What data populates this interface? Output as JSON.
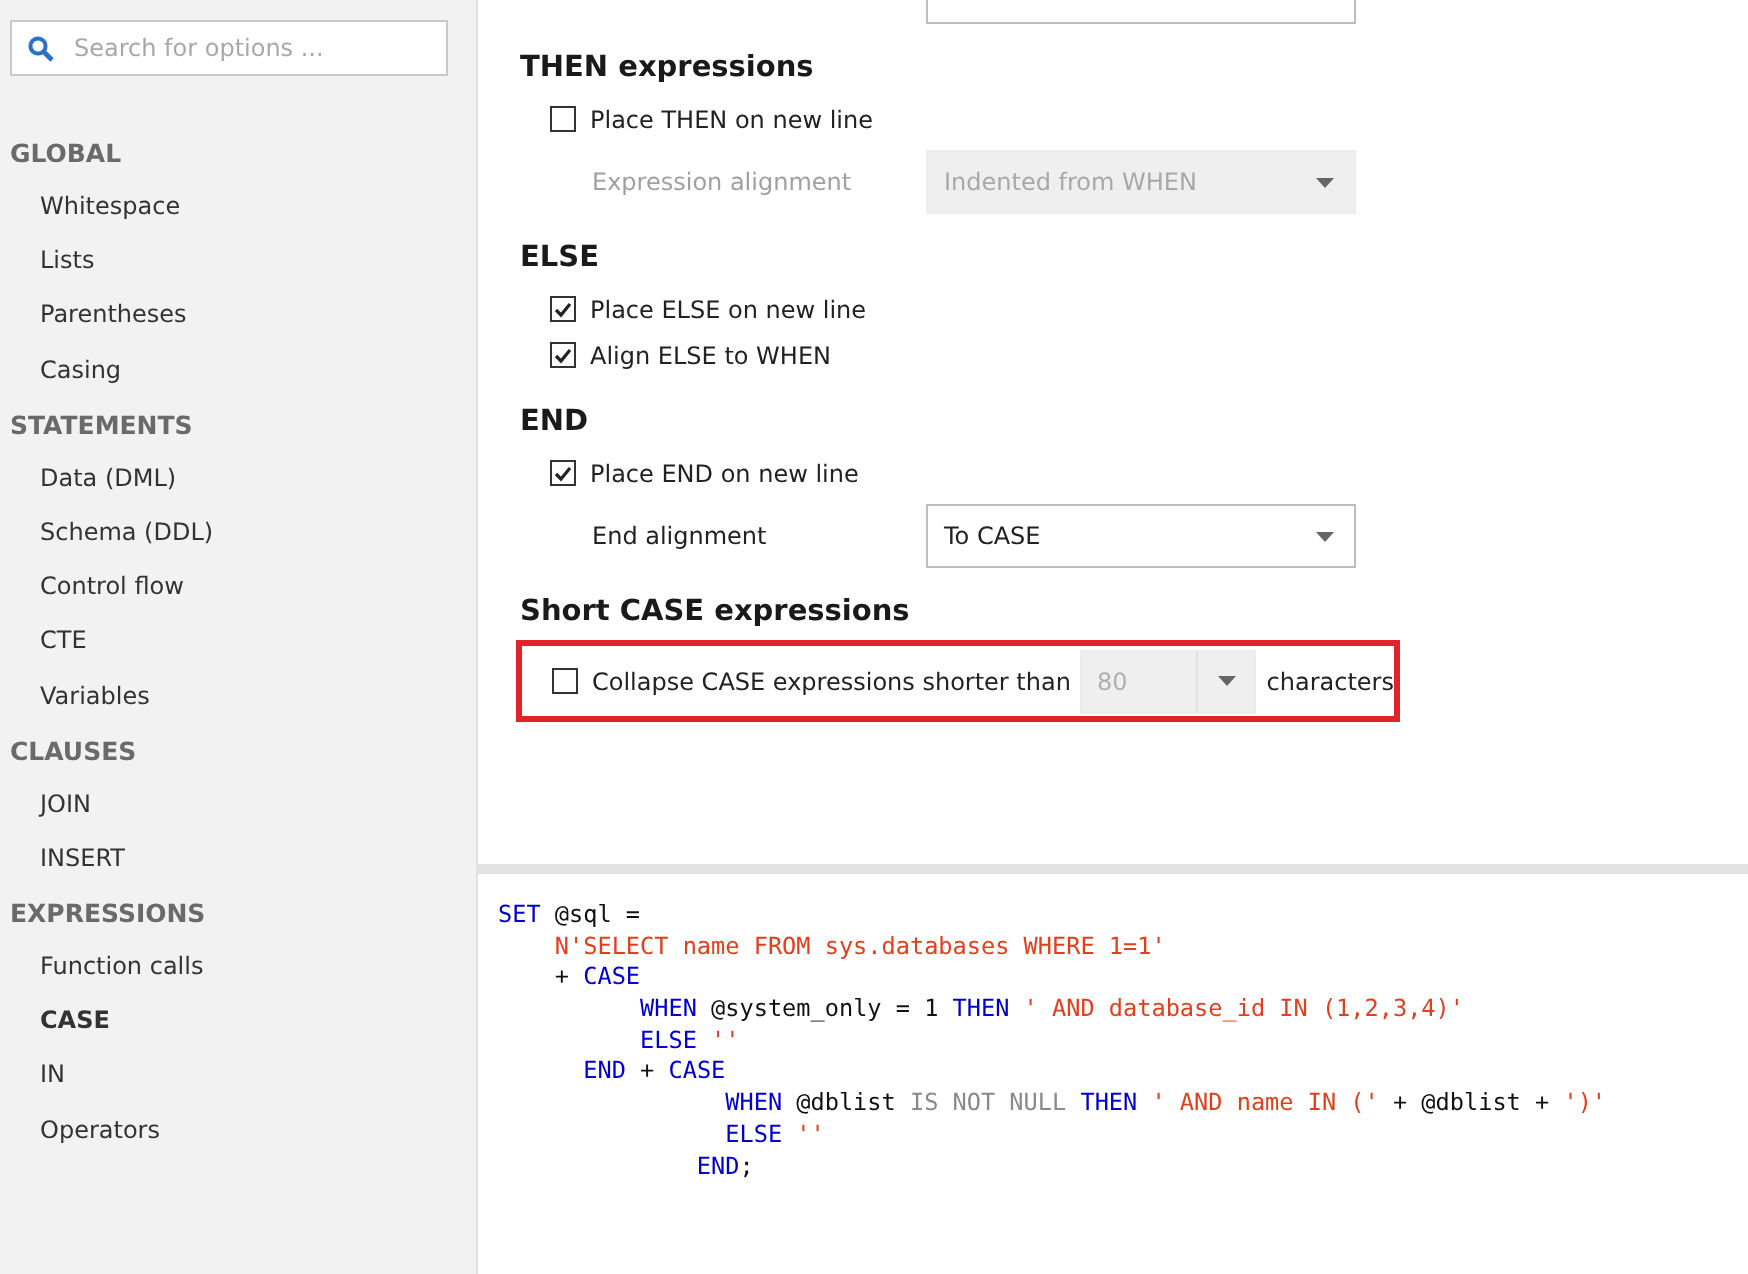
{
  "sidebar": {
    "search": {
      "placeholder": "Search for options ..."
    },
    "groups": [
      {
        "title": "GLOBAL",
        "items": [
          {
            "label": "Whitespace",
            "selected": false
          },
          {
            "label": "Lists",
            "selected": false
          },
          {
            "label": "Parentheses",
            "selected": false
          },
          {
            "label": "Casing",
            "selected": false
          }
        ]
      },
      {
        "title": "STATEMENTS",
        "items": [
          {
            "label": "Data (DML)",
            "selected": false
          },
          {
            "label": "Schema (DDL)",
            "selected": false
          },
          {
            "label": "Control flow",
            "selected": false
          },
          {
            "label": "CTE",
            "selected": false
          },
          {
            "label": "Variables",
            "selected": false
          }
        ]
      },
      {
        "title": "CLAUSES",
        "items": [
          {
            "label": "JOIN",
            "selected": false
          },
          {
            "label": "INSERT",
            "selected": false
          }
        ]
      },
      {
        "title": "EXPRESSIONS",
        "items": [
          {
            "label": "Function calls",
            "selected": false
          },
          {
            "label": "CASE",
            "selected": true
          },
          {
            "label": "IN",
            "selected": false
          },
          {
            "label": "Operators",
            "selected": false
          }
        ]
      }
    ]
  },
  "settings": {
    "sections": [
      {
        "title": "THEN expressions",
        "options": [
          {
            "kind": "checkbox",
            "label": "Place THEN on new line",
            "checked": false
          },
          {
            "kind": "dropdown",
            "label": "Expression alignment",
            "value": "Indented from WHEN",
            "disabled": true
          }
        ]
      },
      {
        "title": "ELSE",
        "options": [
          {
            "kind": "checkbox",
            "label": "Place ELSE on new line",
            "checked": true
          },
          {
            "kind": "checkbox",
            "label": "Align ELSE to WHEN",
            "checked": true
          }
        ]
      },
      {
        "title": "END",
        "options": [
          {
            "kind": "checkbox",
            "label": "Place END on new line",
            "checked": true
          },
          {
            "kind": "dropdown",
            "label": "End alignment",
            "value": "To CASE",
            "disabled": false
          }
        ]
      },
      {
        "title": "Short CASE expressions",
        "options": [
          {
            "kind": "inline",
            "label": "Collapse CASE expressions shorter than",
            "checked": false,
            "value": "80",
            "disabled": true,
            "suffix": "characters",
            "highlighted": true
          }
        ]
      }
    ]
  },
  "code": {
    "lines": [
      [
        {
          "kind": "keyword",
          "text": "SET"
        },
        {
          "kind": "plain",
          "text": " @sql ="
        }
      ],
      [
        {
          "kind": "string",
          "text": "    N'SELECT name FROM sys.databases WHERE 1=1'"
        }
      ],
      [
        {
          "kind": "plain",
          "text": "    + "
        },
        {
          "kind": "keyword",
          "text": "CASE"
        }
      ],
      [
        {
          "kind": "keyword",
          "text": "          WHEN"
        },
        {
          "kind": "plain",
          "text": " @system_only = 1 "
        },
        {
          "kind": "keyword",
          "text": "THEN"
        },
        {
          "kind": "string",
          "text": " ' AND database_id IN (1,2,3,4)'"
        }
      ],
      [
        {
          "kind": "keyword",
          "text": "          ELSE"
        },
        {
          "kind": "string",
          "text": " ''"
        }
      ],
      [
        {
          "kind": "keyword",
          "text": "      END"
        },
        {
          "kind": "plain",
          "text": " + "
        },
        {
          "kind": "keyword",
          "text": "CASE"
        }
      ],
      [
        {
          "kind": "keyword",
          "text": "                WHEN"
        },
        {
          "kind": "plain",
          "text": " @dblist "
        },
        {
          "kind": "operator",
          "text": "IS NOT NULL"
        },
        {
          "kind": "keyword",
          "text": " THEN"
        },
        {
          "kind": "string",
          "text": " ' AND name IN ('"
        },
        {
          "kind": "plain",
          "text": " + @dblist + "
        },
        {
          "kind": "string",
          "text": "')'"
        }
      ],
      [
        {
          "kind": "keyword",
          "text": "                ELSE"
        },
        {
          "kind": "string",
          "text": " ''"
        }
      ],
      [
        {
          "kind": "keyword",
          "text": "              END"
        },
        {
          "kind": "plain",
          "text": ";"
        }
      ]
    ]
  }
}
